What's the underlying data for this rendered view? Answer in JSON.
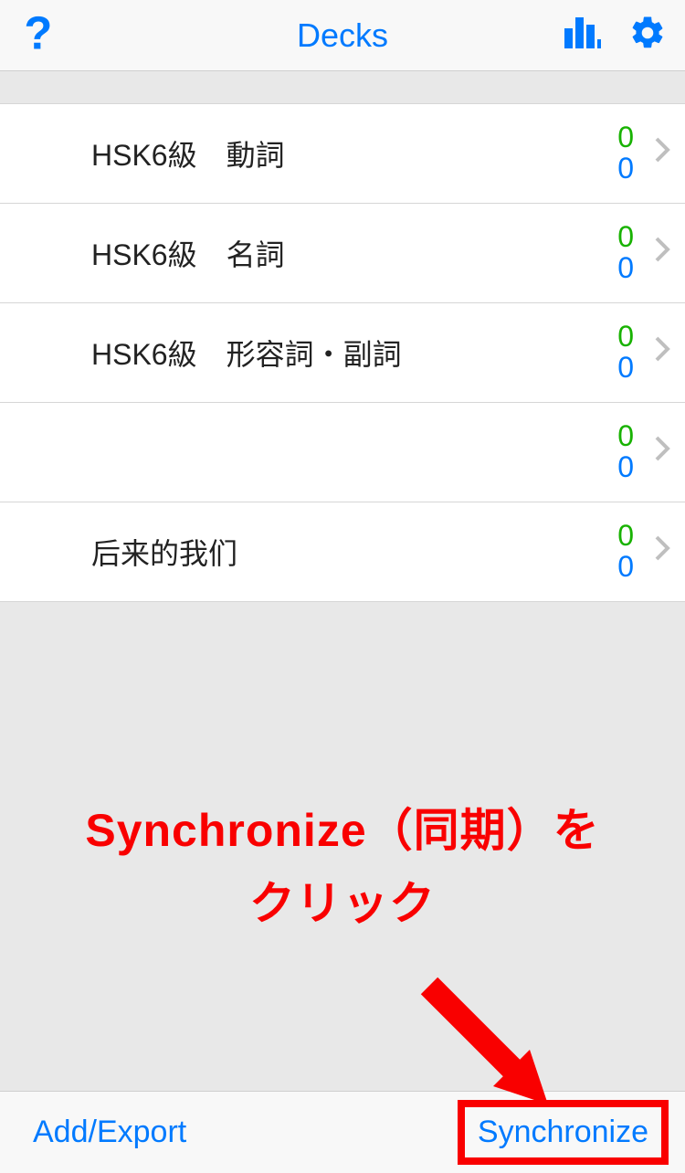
{
  "header": {
    "title": "Decks"
  },
  "decks": [
    {
      "name": "HSK6級　動詞",
      "new": "0",
      "due": "0",
      "redacted": false
    },
    {
      "name": "HSK6級　名詞",
      "new": "0",
      "due": "0",
      "redacted": false
    },
    {
      "name": "HSK6級　形容詞・副詞",
      "new": "0",
      "due": "0",
      "redacted": false
    },
    {
      "name": "",
      "new": "0",
      "due": "0",
      "redacted": true
    },
    {
      "name": "后来的我们",
      "new": "0",
      "due": "0",
      "redacted": false
    }
  ],
  "annotation": {
    "line1": "Synchronize（同期）を",
    "line2": "クリック"
  },
  "toolbar": {
    "add_export": "Add/Export",
    "synchronize": "Synchronize"
  }
}
